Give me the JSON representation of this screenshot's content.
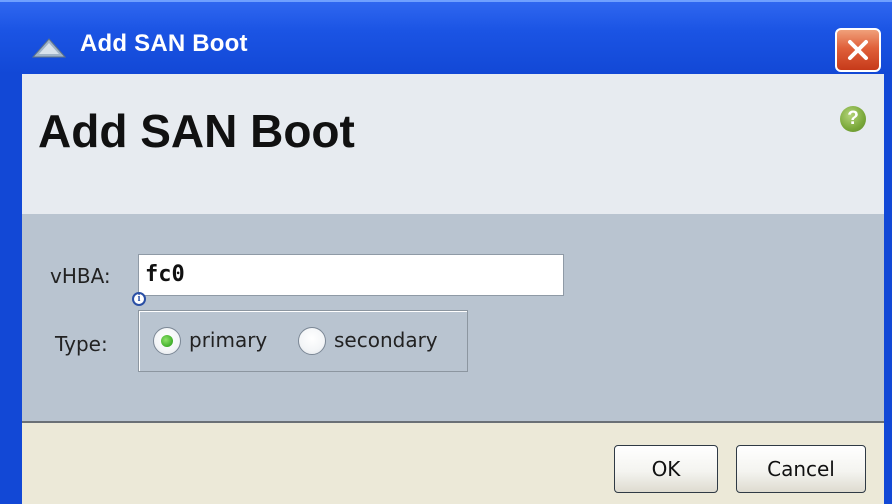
{
  "window": {
    "title": "Add SAN Boot",
    "close_icon": "close-icon",
    "title_icon": "app-triangle-icon"
  },
  "header": {
    "title": "Add SAN Boot",
    "help_icon": "help-icon",
    "help_glyph": "?"
  },
  "form": {
    "vhba_label": "vHBA:",
    "vhba_value": "fc0",
    "info_glyph": "i",
    "type_label": "Type:",
    "type_options": [
      {
        "label": "primary",
        "selected": true
      },
      {
        "label": "secondary",
        "selected": false
      }
    ]
  },
  "footer": {
    "ok_label": "OK",
    "cancel_label": "Cancel"
  },
  "colors": {
    "titlebar": "#1b54e4",
    "header_bg": "#e7ebf0",
    "content_bg": "#b9c4d0",
    "footer_bg": "#ece9d8",
    "help_green": "#7aa83a",
    "radio_selected": "#3fae2a"
  }
}
